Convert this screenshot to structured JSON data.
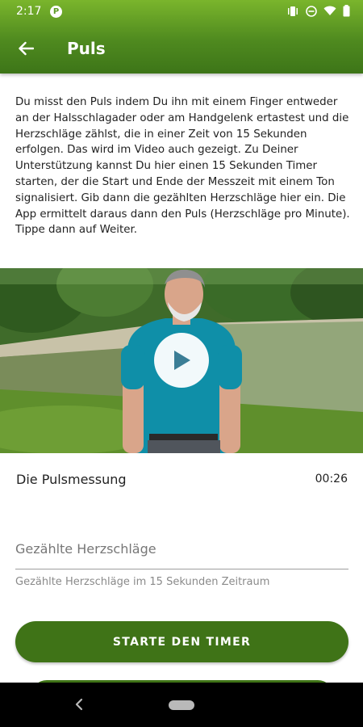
{
  "status_bar": {
    "time": "2:17",
    "app_icon": "P"
  },
  "app_bar": {
    "title": "Puls",
    "back_icon": "arrow-left-icon"
  },
  "description": "Du misst den Puls indem Du ihn mit einem Finger entweder an der Halsschlagader oder am Handgelenk ertastest und die Herzschläge zählst, die in einer Zeit von 15 Sekunden erfolgen. Das wird im Video auch gezeigt. Zu Deiner Unterstützung kannst Du hier einen 15 Sekunden Timer starten, der die Start und Ende der Messzeit mit einem Ton signalisiert. Gib dann die gezählten Herzschläge hier ein. Die App ermittelt daraus dann den Puls (Herzschläge pro Minute). Tippe dann auf Weiter.",
  "video": {
    "title": "Die Pulsmessung",
    "duration": "00:26",
    "play_icon": "play-icon"
  },
  "input": {
    "placeholder": "Gezählte Herzschläge",
    "value": "",
    "helper": "Gezählte Herzschläge im 15 Sekunden Zeitraum"
  },
  "buttons": {
    "start_timer": "STARTE DEN TIMER"
  },
  "colors": {
    "app_bar": "#4f8a1f",
    "button": "#3f7317"
  }
}
